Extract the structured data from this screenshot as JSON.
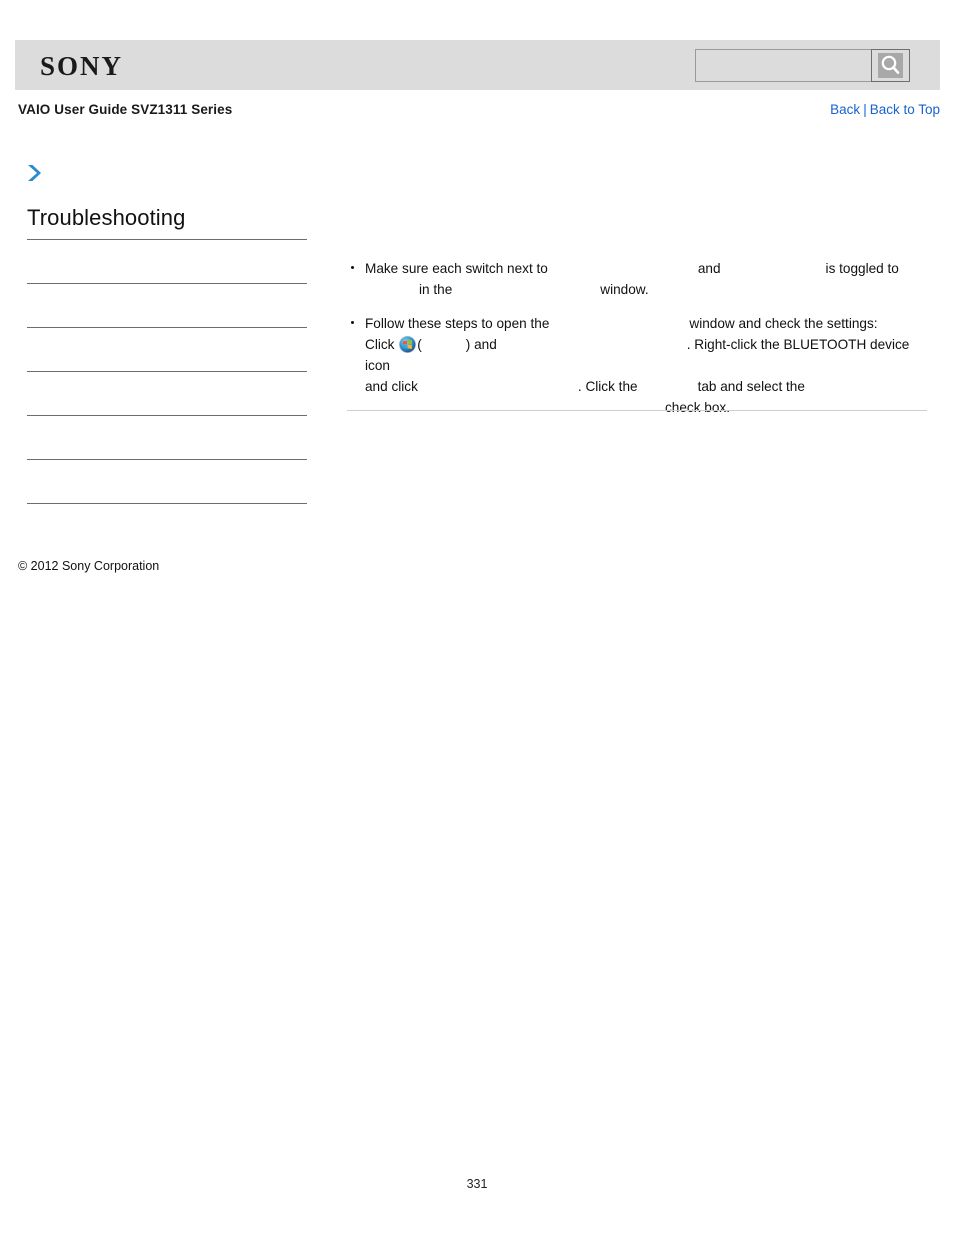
{
  "header": {
    "logo_text": "SONY",
    "search": {
      "value": "",
      "placeholder": "",
      "icon": "search-icon"
    }
  },
  "subheader": {
    "doc_title": "VAIO User Guide SVZ1311 Series",
    "links": {
      "back": "Back",
      "separator": "|",
      "back_to_top": "Back to Top"
    }
  },
  "sidebar": {
    "expand_icon": "chevron-right-icon",
    "title": "Troubleshooting",
    "items": [
      {
        "label": ""
      },
      {
        "label": ""
      },
      {
        "label": ""
      },
      {
        "label": ""
      },
      {
        "label": ""
      },
      {
        "label": ""
      }
    ]
  },
  "main": {
    "bullets": [
      {
        "id": "switch-toggle-bullet",
        "line1_a": "Make sure each switch next to",
        "line1_blank1_width": 150,
        "line1_b": "and",
        "line1_blank2_width": 105,
        "line1_c": "is toggled to",
        "line2_blank1_width": 36,
        "line2_a": "in the",
        "line2_blank2_width": 148,
        "line2_b": "window."
      },
      {
        "id": "open-window-steps-bullet",
        "line1_a": "Follow these steps to open the",
        "line1_blank1_width": 140,
        "line1_b": "window and check the settings:",
        "line2_a": "Click",
        "line2_icon": "windows-start-orb-icon",
        "line2_b": "(",
        "line2_blank1_width": 44,
        "line2_c": ") and",
        "line2_blank2_width": 190,
        "line2_d": ". Right-click the BLUETOOTH device icon",
        "line3_a": "and click",
        "line3_blank1_width": 160,
        "line3_b": ". Click the",
        "line3_blank2_width": 60,
        "line3_c": "tab and select the",
        "line4_blank1_width": 300,
        "line4_a": "check box."
      }
    ]
  },
  "footer": {
    "copyright": "© 2012 Sony Corporation",
    "page_number": "331"
  },
  "colors": {
    "header_bar": "#dcdcdc",
    "link": "#1763cf",
    "chevron": "#2a8ccc",
    "rule": "#6d6d6d",
    "content_rule": "#cfcfcf"
  }
}
